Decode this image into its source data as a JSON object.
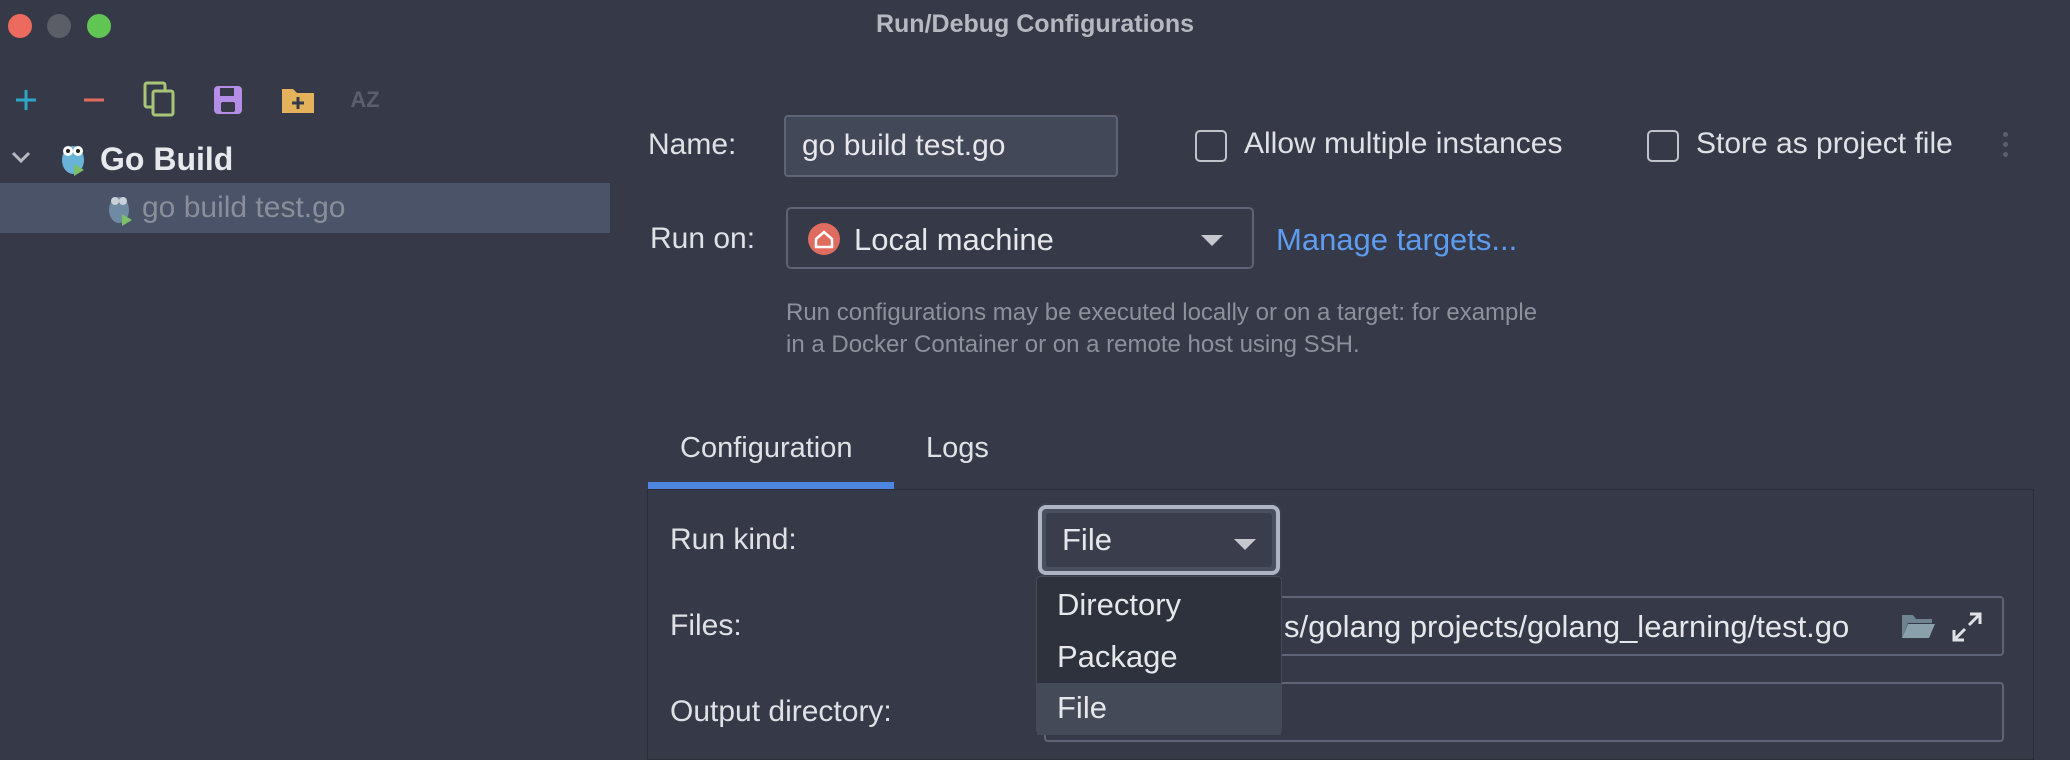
{
  "window": {
    "title": "Run/Debug Configurations"
  },
  "toolbar": {
    "buttons": [
      {
        "name": "add-icon",
        "glyph": "+",
        "color": "#2fa6c9"
      },
      {
        "name": "remove-icon",
        "glyph": "−",
        "color": "#e06c60"
      },
      {
        "name": "copy-icon",
        "color": "#a8c476"
      },
      {
        "name": "save-icon",
        "color": "#b48ee6"
      },
      {
        "name": "new-folder-icon",
        "color": "#e5b25c"
      },
      {
        "name": "sort-az-icon",
        "glyph": "AZ",
        "color": "#5b5f6b"
      }
    ]
  },
  "tree": {
    "group_label": "Go Build",
    "child_label": "go build test.go"
  },
  "form": {
    "name_label": "Name:",
    "name_value": "go build test.go",
    "allow_multiple_label": "Allow multiple instances",
    "store_project_label": "Store as project file",
    "run_on_label": "Run on:",
    "run_on_value": "Local machine",
    "manage_targets": "Manage targets...",
    "hint_line1": "Run configurations may be executed locally or on a target: for example",
    "hint_line2": "in a Docker Container or on a remote host using SSH."
  },
  "tabs": [
    {
      "label": "Configuration",
      "active": true
    },
    {
      "label": "Logs",
      "active": false
    }
  ],
  "config": {
    "run_kind_label": "Run kind:",
    "run_kind_value": "File",
    "files_label": "Files:",
    "files_value": "s/golang projects/golang_learning/test.go",
    "output_dir_label": "Output directory:",
    "output_dir_value": ""
  },
  "run_kind_options": [
    {
      "label": "Directory",
      "selected": false
    },
    {
      "label": "Package",
      "selected": false
    },
    {
      "label": "File",
      "selected": true
    }
  ],
  "colors": {
    "background": "#363a48",
    "selection": "#4b5369",
    "accent": "#4c86e0",
    "link": "#5e9cf0"
  }
}
